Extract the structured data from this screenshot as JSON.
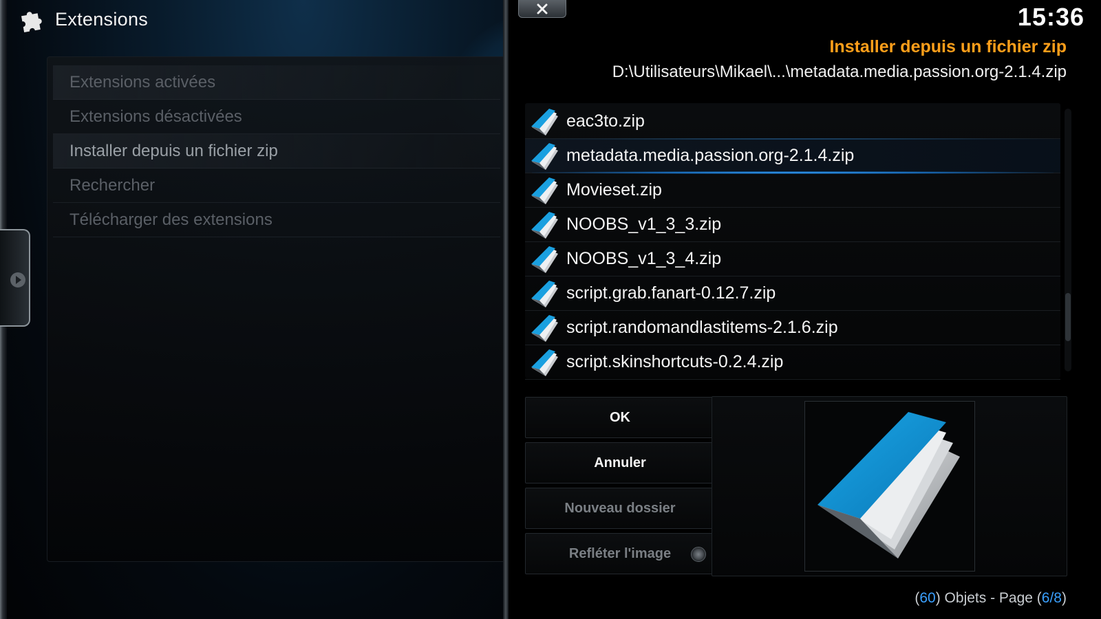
{
  "header": {
    "title": "Extensions",
    "icon": "puzzle-icon"
  },
  "menu": {
    "items": [
      {
        "label": "Extensions activées"
      },
      {
        "label": "Extensions désactivées"
      },
      {
        "label": "Installer depuis un fichier zip"
      },
      {
        "label": "Rechercher"
      },
      {
        "label": "Télécharger des extensions"
      }
    ]
  },
  "dialog": {
    "clock": "15:36",
    "heading": "Installer depuis un fichier zip",
    "path": "D:\\Utilisateurs\\Mikael\\...\\metadata.media.passion.org-2.1.4.zip",
    "files": [
      {
        "name": "eac3to.zip"
      },
      {
        "name": "metadata.media.passion.org-2.1.4.zip"
      },
      {
        "name": "Movieset.zip"
      },
      {
        "name": "NOOBS_v1_3_3.zip"
      },
      {
        "name": "NOOBS_v1_3_4.zip"
      },
      {
        "name": "script.grab.fanart-0.12.7.zip"
      },
      {
        "name": "script.randomandlastitems-2.1.6.zip"
      },
      {
        "name": "script.skinshortcuts-0.2.4.zip"
      }
    ],
    "focused_index": 1,
    "buttons": {
      "ok": "OK",
      "cancel": "Annuler",
      "new_folder": "Nouveau dossier",
      "flip_image": "Refléter l'image"
    },
    "footer": {
      "open_paren": "(",
      "count": "60",
      "objects_text": ") Objets - Page (",
      "page": "6/8",
      "close_paren": ")"
    }
  },
  "colors": {
    "accent_orange": "#ff9f1a",
    "accent_blue": "#3aa0ff",
    "focus_glow": "#1767b3"
  }
}
